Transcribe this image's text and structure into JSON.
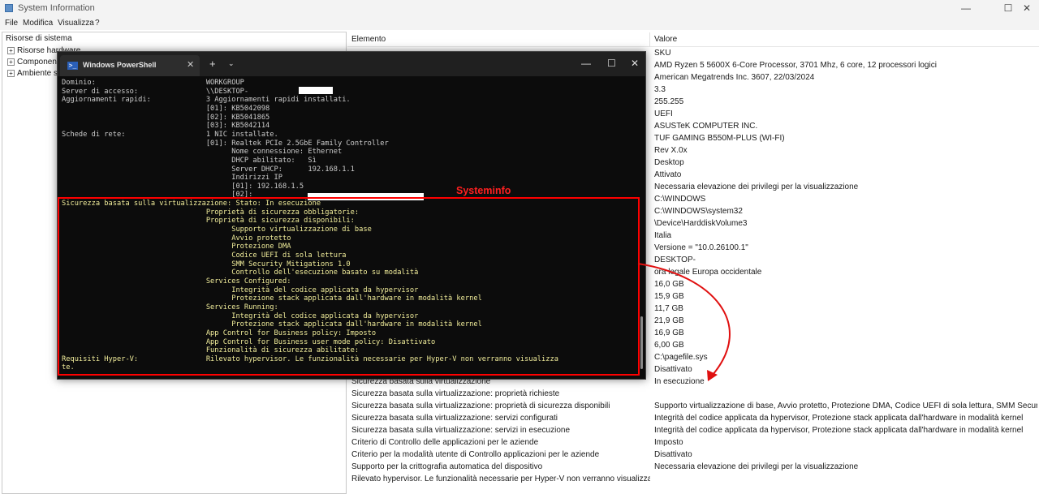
{
  "window": {
    "title": "System Information",
    "minimize": "—",
    "maximize": "☐",
    "close": "✕"
  },
  "menu": [
    "File",
    "Modifica",
    "Visualizza",
    "?"
  ],
  "tree": {
    "root": "Risorse di sistema",
    "items": [
      {
        "label": "Risorse hardware",
        "expander": "+"
      },
      {
        "label": "Componenti",
        "expander": "+"
      },
      {
        "label": "Ambiente software",
        "expander": "+"
      }
    ]
  },
  "table": {
    "headers": [
      "Elemento",
      "Valore"
    ],
    "rows": [
      {
        "element": "",
        "value": "SKU"
      },
      {
        "element": "",
        "value": "AMD Ryzen 5 5600X 6-Core Processor, 3701 Mhz, 6 core, 12 processori logici"
      },
      {
        "element": "",
        "value": "American Megatrends Inc. 3607, 22/03/2024"
      },
      {
        "element": "",
        "value": "3.3"
      },
      {
        "element": "",
        "value": "255.255"
      },
      {
        "element": "",
        "value": "UEFI"
      },
      {
        "element": "",
        "value": "ASUSTeK COMPUTER INC."
      },
      {
        "element": "",
        "value": "TUF GAMING B550M-PLUS (WI-FI)"
      },
      {
        "element": "",
        "value": "Rev X.0x"
      },
      {
        "element": "",
        "value": "Desktop"
      },
      {
        "element": "",
        "value": "Attivato"
      },
      {
        "element": "",
        "value": "Necessaria elevazione dei privilegi per la visualizzazione"
      },
      {
        "element": "",
        "value": "C:\\WINDOWS"
      },
      {
        "element": "",
        "value": "C:\\WINDOWS\\system32"
      },
      {
        "element": "",
        "value": "\\Device\\HarddiskVolume3"
      },
      {
        "element": "",
        "value": "Italia"
      },
      {
        "element": "",
        "value": "Versione = \"10.0.26100.1\""
      },
      {
        "element": "",
        "value": "DESKTOP-"
      },
      {
        "element": "",
        "value": "ora legale Europa occidentale"
      },
      {
        "element": "",
        "value": "16,0 GB"
      },
      {
        "element": "",
        "value": "15,9 GB"
      },
      {
        "element": "",
        "value": "11,7 GB"
      },
      {
        "element": "",
        "value": "21,9 GB"
      },
      {
        "element": "",
        "value": "16,9 GB"
      },
      {
        "element": "",
        "value": "6,00 GB"
      },
      {
        "element": "",
        "value": "C:\\pagefile.sys"
      },
      {
        "element": "",
        "value": "Disattivato"
      },
      {
        "element": "Sicurezza basata sulla virtualizzazione",
        "value": "In esecuzione"
      },
      {
        "element": "Sicurezza basata sulla virtualizzazione: proprietà richieste",
        "value": ""
      },
      {
        "element": "Sicurezza basata sulla virtualizzazione: proprietà di sicurezza disponibili",
        "value": "Supporto virtualizzazione di base, Avvio protetto, Protezione DMA, Codice UEFI di sola lettura, SMM Security..."
      },
      {
        "element": "Sicurezza basata sulla virtualizzazione: servizi configurati",
        "value": "Integrità del codice applicata da hypervisor, Protezione stack applicata dall'hardware in modalità kernel"
      },
      {
        "element": "Sicurezza basata sulla virtualizzazione: servizi in esecuzione",
        "value": "Integrità del codice applicata da hypervisor, Protezione stack applicata dall'hardware in modalità kernel"
      },
      {
        "element": "Criterio di Controllo delle applicazioni per le aziende",
        "value": "Imposto"
      },
      {
        "element": "Criterio per la modalità utente di Controllo applicazioni per le aziende",
        "value": "Disattivato"
      },
      {
        "element": "Supporto per la crittografia automatica del dispositivo",
        "value": "Necessaria elevazione dei privilegi per la visualizzazione"
      },
      {
        "element": "Rilevato hypervisor. Le funzionalità necessarie per Hyper-V non verranno visualizzate.",
        "value": ""
      }
    ]
  },
  "powershell": {
    "tab_title": "Windows PowerShell",
    "tab_icon": ">_",
    "lines": [
      "Dominio:                          WORKGROUP",
      "Server di accesso:                \\\\DESKTOP-",
      "Aggiornamenti rapidi:             3 Aggiornamenti rapidi installati.",
      "                                  [01]: KB5042098",
      "                                  [02]: KB5041865",
      "                                  [03]: KB5042114",
      "Schede di rete:                   1 NIC installate.",
      "                                  [01]: Realtek PCIe 2.5GbE Family Controller",
      "                                        Nome connessione: Ethernet",
      "                                        DHCP abilitato:   Sì",
      "                                        Server DHCP:      192.168.1.1",
      "                                        Indirizzi IP",
      "                                        [01]: 192.168.1.5",
      "                                        [02]:",
      "Sicurezza basata sulla virtualizzazione: Stato: In esecuzione",
      "                                  Proprietà di sicurezza obbligatorie:",
      "                                  Proprietà di sicurezza disponibili:",
      "                                        Supporto virtualizzazione di base",
      "                                        Avvio protetto",
      "                                        Protezione DMA",
      "                                        Codice UEFI di sola lettura",
      "                                        SMM Security Mitigations 1.0",
      "                                        Controllo dell'esecuzione basato su modalità",
      "                                  Services Configured:",
      "                                        Integrità del codice applicata da hypervisor",
      "                                        Protezione stack applicata dall'hardware in modalità kernel",
      "                                  Services Running:",
      "                                        Integrità del codice applicata da hypervisor",
      "                                        Protezione stack applicata dall'hardware in modalità kernel",
      "                                  App Control for Business policy: Imposto",
      "                                  App Control for Business user mode policy: Disattivato",
      "                                  Funzionalità di sicurezza abilitate:",
      "Requisiti Hyper-V:                Rilevato hypervisor. Le funzionalità necessarie per Hyper-V non verranno visualizza",
      "te."
    ]
  },
  "annotation": {
    "label": "Systeminfo",
    "color": "#ff0000"
  },
  "colors": {
    "highlight": "#fdfd96",
    "terminal_bg": "#0c0c0c",
    "terminal_text": "#cccccc",
    "terminal_yellow": "#f0ec9a"
  }
}
